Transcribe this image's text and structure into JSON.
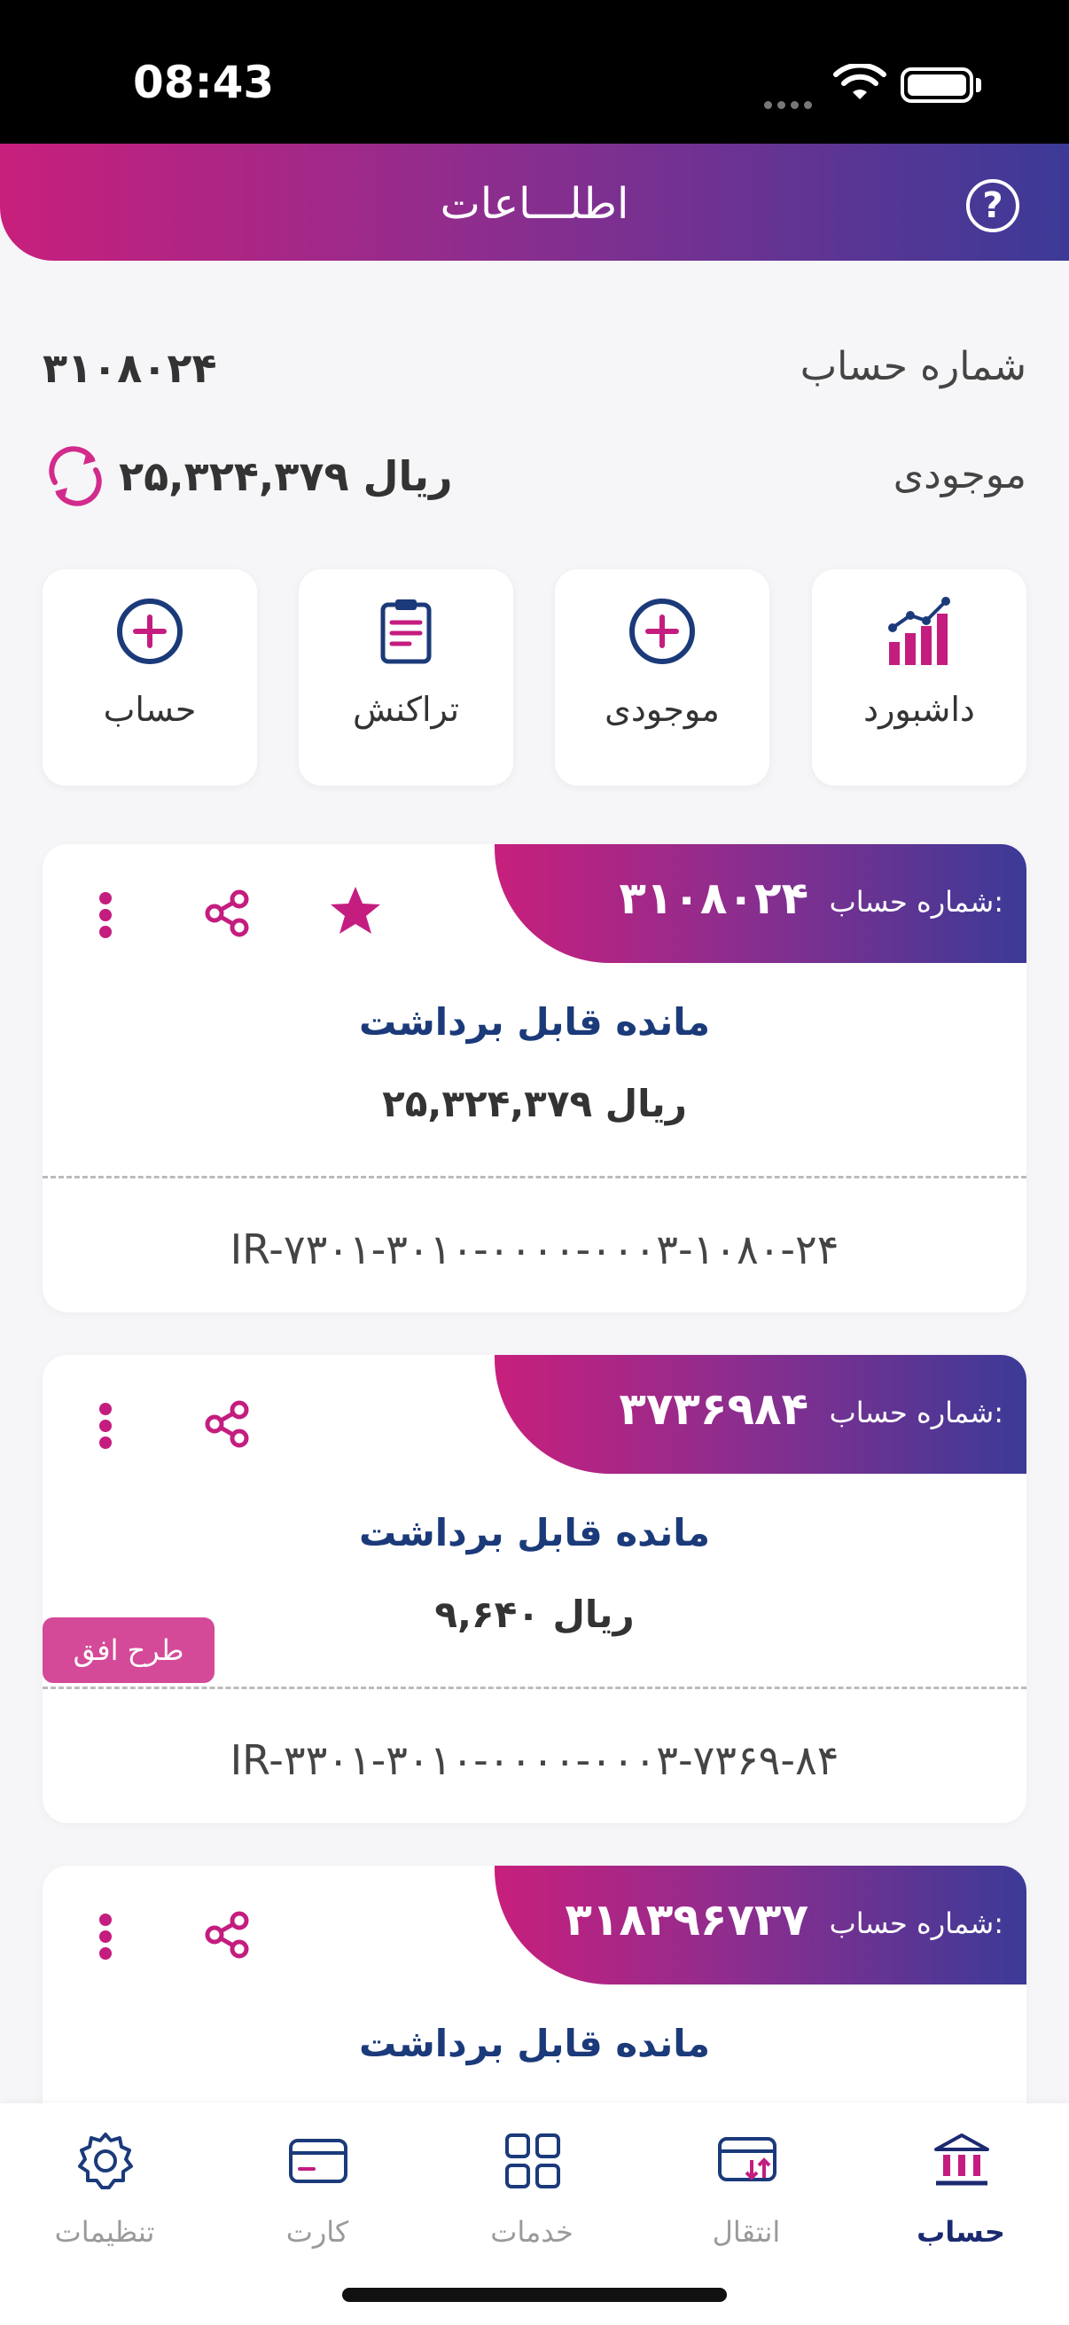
{
  "status": {
    "time": "08:43"
  },
  "header": {
    "title": "اطلـــاعات",
    "help_glyph": "?"
  },
  "account_info": {
    "number_label": "شماره حساب",
    "number_value": "۳۱۰۸۰۲۴",
    "balance_label": "موجودی",
    "balance_value": "۲۵,۳۲۴,۳۷۹ ریال"
  },
  "actions": [
    {
      "label": "داشبورد",
      "icon": "chart-icon"
    },
    {
      "label": "موجودی",
      "icon": "plus-circle-icon"
    },
    {
      "label": "تراکنش",
      "icon": "clipboard-icon"
    },
    {
      "label": "حساب",
      "icon": "plus-circle-icon"
    }
  ],
  "cards": [
    {
      "caption_label": "شماره حساب:",
      "account_number": "۳۱۰۸۰۲۴",
      "available_label": "مانده قابل برداشت",
      "amount": "۲۵,۳۲۴,۳۷۹ ریال",
      "iban": "IR-۷۳۰۱-۳۰۱۰-۰۰۰۰-۰۰۰۳-۱۰۸۰-۲۴",
      "favorite": true
    },
    {
      "caption_label": "شماره حساب:",
      "account_number": "۳۷۳۶۹۸۴",
      "available_label": "مانده قابل برداشت",
      "amount": "۹,۶۴۰ ریال",
      "iban": "IR-۳۳۰۱-۳۰۱۰-۰۰۰۰-۰۰۰۳-۷۳۶۹-۸۴",
      "tag": "طرح افق"
    },
    {
      "caption_label": "شماره حساب:",
      "account_number": "۳۱۸۳۹۶۷۳۷",
      "available_label": "مانده قابل برداشت"
    }
  ],
  "tabs": [
    {
      "label": "تنظیمات",
      "icon": "gear-icon"
    },
    {
      "label": "کارت",
      "icon": "card-icon"
    },
    {
      "label": "خدمات",
      "icon": "grid-icon"
    },
    {
      "label": "انتقال",
      "icon": "transfer-icon"
    },
    {
      "label": "حساب",
      "icon": "bank-icon",
      "active": true
    }
  ],
  "colors": {
    "accent": "#c41d7f",
    "navy": "#1b3a7a",
    "gradient_start": "#c81f7c",
    "gradient_end": "#3c3a97"
  }
}
